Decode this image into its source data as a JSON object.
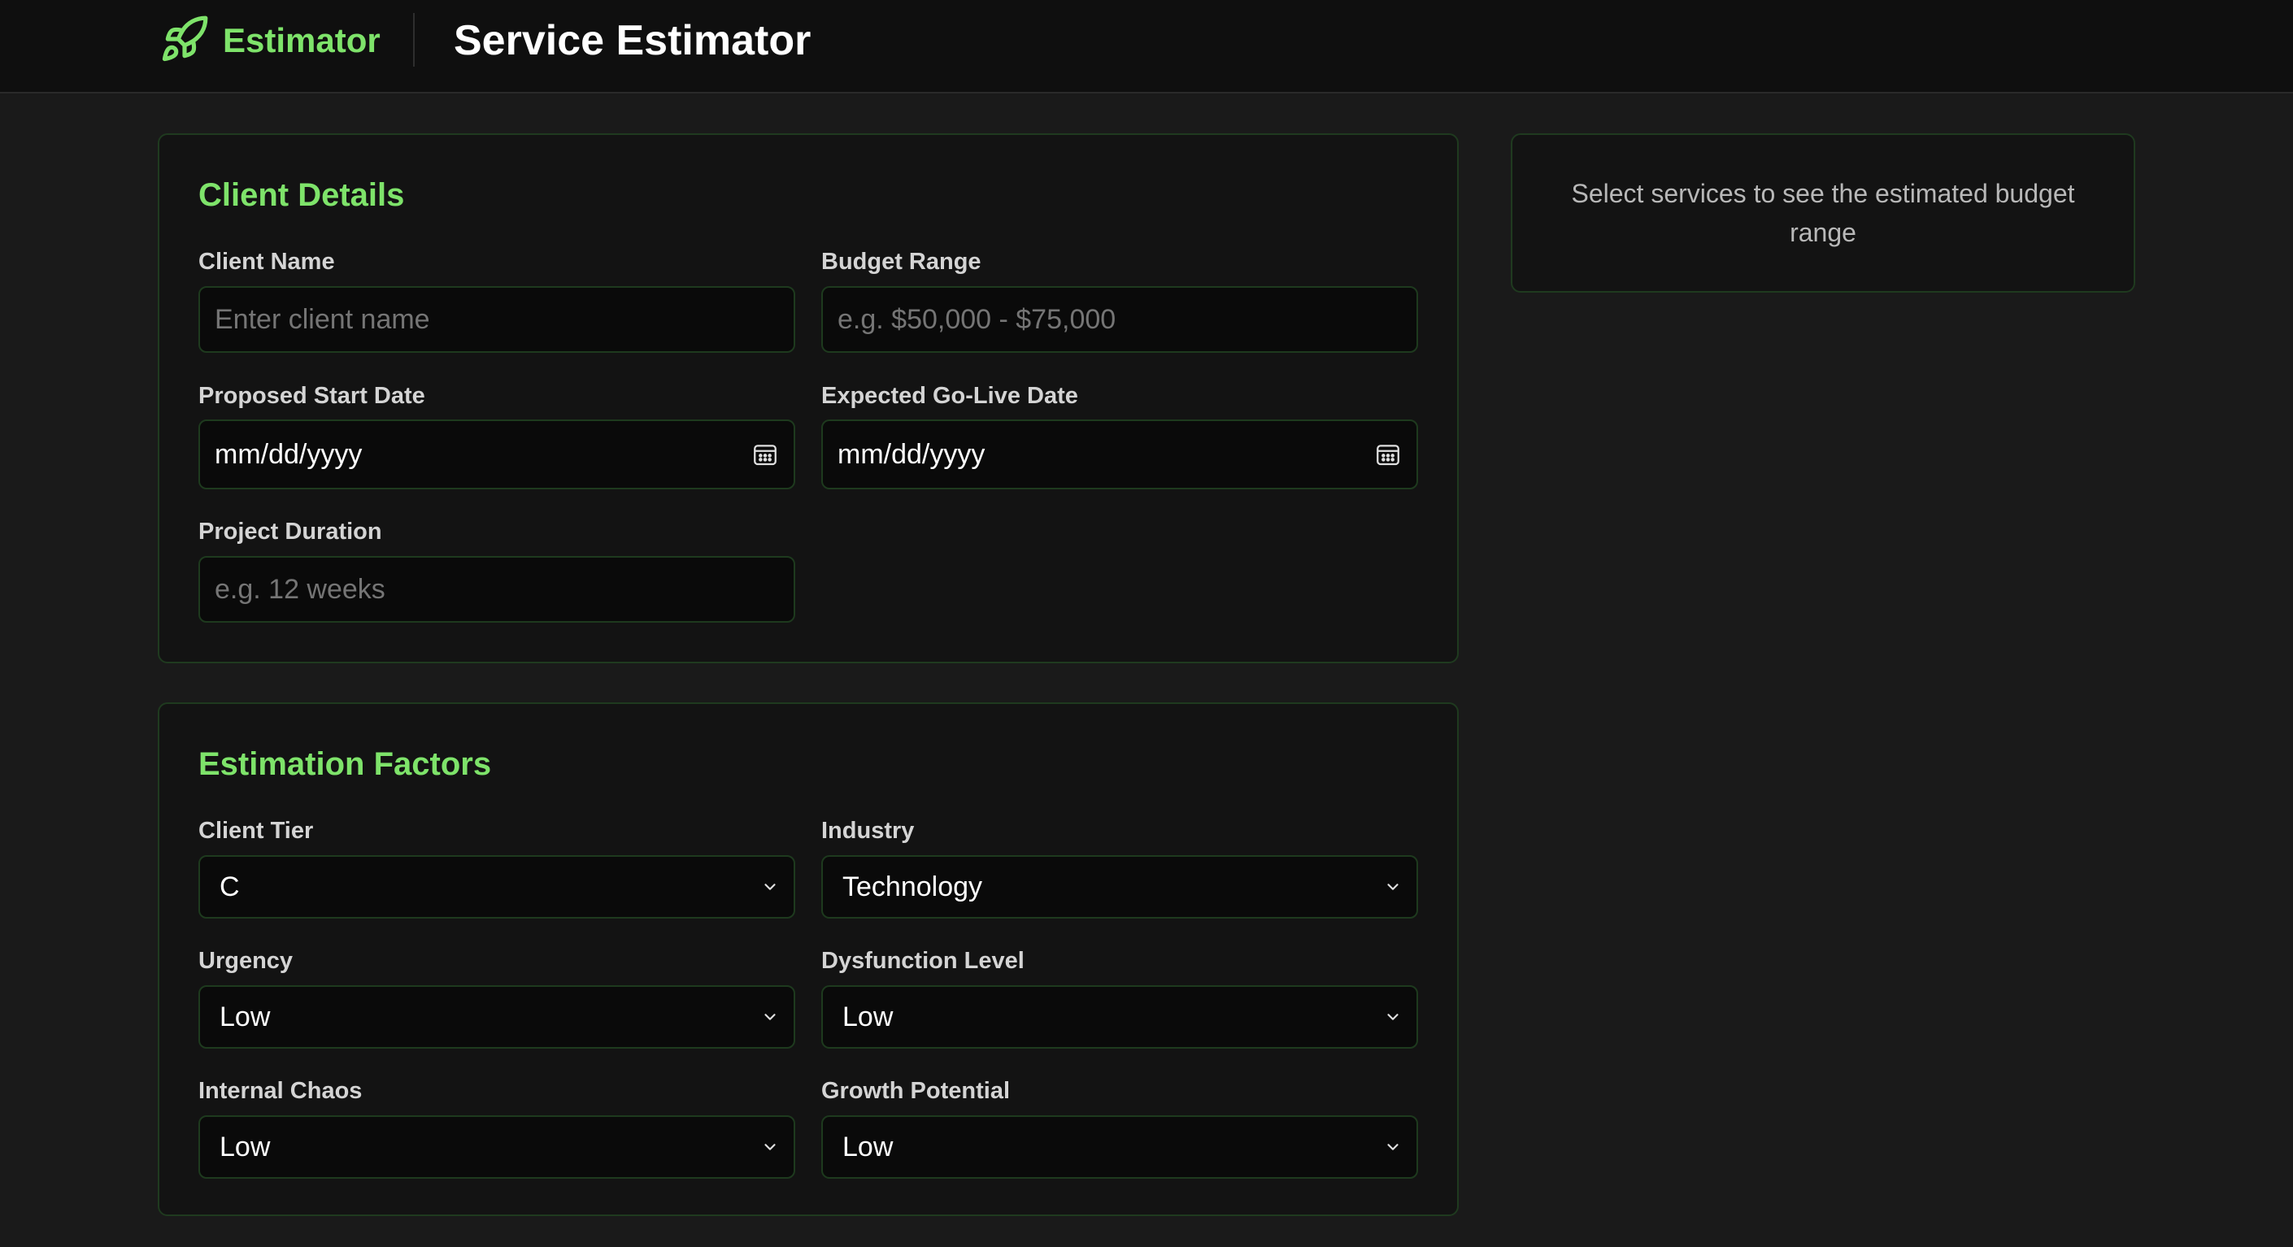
{
  "header": {
    "brand_name": "Estimator",
    "brand_icon": "rocket-icon",
    "page_title": "Service Estimator",
    "accent_color": "#7ee36a"
  },
  "client_details": {
    "title": "Client Details",
    "client_name": {
      "label": "Client Name",
      "placeholder": "Enter client name",
      "value": ""
    },
    "budget_range": {
      "label": "Budget Range",
      "placeholder": "e.g. $50,000 - $75,000",
      "value": ""
    },
    "start_date": {
      "label": "Proposed Start Date",
      "value": "mm/dd/yyyy"
    },
    "go_live_date": {
      "label": "Expected Go-Live Date",
      "value": "mm/dd/yyyy"
    },
    "project_duration": {
      "label": "Project Duration",
      "placeholder": "e.g. 12 weeks",
      "value": ""
    }
  },
  "estimation_factors": {
    "title": "Estimation Factors",
    "client_tier": {
      "label": "Client Tier",
      "value": "C"
    },
    "industry": {
      "label": "Industry",
      "value": "Technology"
    },
    "urgency": {
      "label": "Urgency",
      "value": "Low"
    },
    "dysfunction_level": {
      "label": "Dysfunction Level",
      "value": "Low"
    },
    "internal_chaos": {
      "label": "Internal Chaos",
      "value": "Low"
    },
    "growth_potential": {
      "label": "Growth Potential",
      "value": "Low"
    }
  },
  "summary": {
    "message": "Select services to see the estimated budget range"
  }
}
